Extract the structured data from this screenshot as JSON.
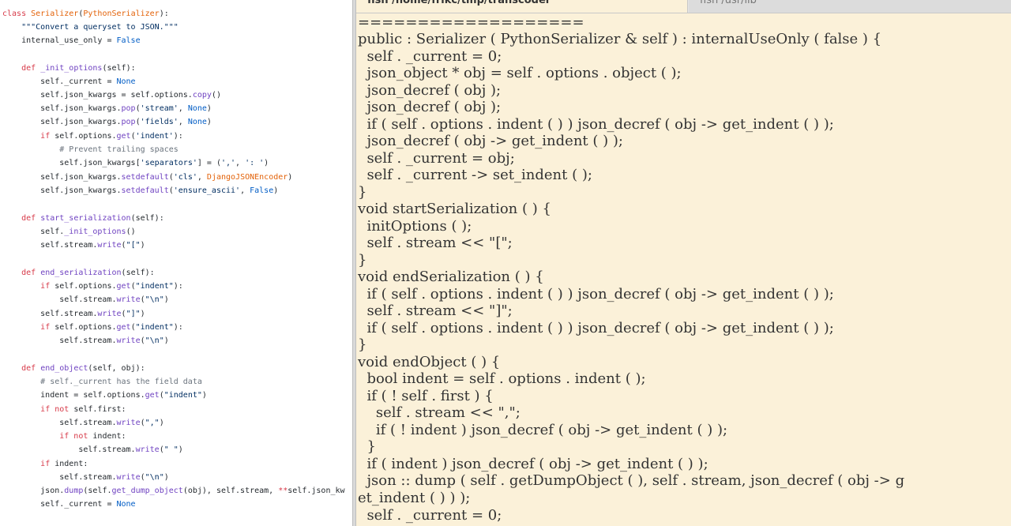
{
  "left_editor": {
    "line_1": {
      "a": "class ",
      "b": "Serializer",
      "c": "(",
      "d": "PythonSerializer",
      "e": "):"
    },
    "line_2": {
      "a": "    \"\"\"Convert a queryset to JSON.\"\"\""
    },
    "line_3": {
      "a": "    internal_use_only = ",
      "b": "False"
    },
    "line_5": {
      "a": "    ",
      "b": "def ",
      "c": "_init_options",
      "d": "(self):"
    },
    "line_6": {
      "a": "        self._current = ",
      "b": "None"
    },
    "line_7": {
      "a": "        self.json_kwargs = self.options.",
      "b": "copy",
      "c": "()"
    },
    "line_8": {
      "a": "        self.json_kwargs.",
      "b": "pop",
      "c": "(",
      "d": "'stream'",
      "e": ", ",
      "f": "None",
      "g": ")"
    },
    "line_9": {
      "a": "        self.json_kwargs.",
      "b": "pop",
      "c": "(",
      "d": "'fields'",
      "e": ", ",
      "f": "None",
      "g": ")"
    },
    "line_10": {
      "a": "        ",
      "b": "if ",
      "c": "self.options.",
      "d": "get",
      "e": "(",
      "f": "'indent'",
      "g": "):"
    },
    "line_11": {
      "a": "            # Prevent trailing spaces"
    },
    "line_12": {
      "a": "            self.json_kwargs[",
      "b": "'separators'",
      "c": "] = (",
      "d": "','",
      "e": ", ",
      "f": "': '",
      "g": ")"
    },
    "line_13": {
      "a": "        self.json_kwargs.",
      "b": "setdefault",
      "c": "(",
      "d": "'cls'",
      "e": ", ",
      "f": "DjangoJSONEncoder",
      "g": ")"
    },
    "line_14": {
      "a": "        self.json_kwargs.",
      "b": "setdefault",
      "c": "(",
      "d": "'ensure_ascii'",
      "e": ", ",
      "f": "False",
      "g": ")"
    },
    "line_16": {
      "a": "    ",
      "b": "def ",
      "c": "start_serialization",
      "d": "(self):"
    },
    "line_17": {
      "a": "        self.",
      "b": "_init_options",
      "c": "()"
    },
    "line_18": {
      "a": "        self.stream.",
      "b": "write",
      "c": "(",
      "d": "\"[\"",
      "e": ")"
    },
    "line_20": {
      "a": "    ",
      "b": "def ",
      "c": "end_serialization",
      "d": "(self):"
    },
    "line_21": {
      "a": "        ",
      "b": "if ",
      "c": "self.options.",
      "d": "get",
      "e": "(",
      "f": "\"indent\"",
      "g": "):"
    },
    "line_22": {
      "a": "            self.stream.",
      "b": "write",
      "c": "(",
      "d": "\"\\n\"",
      "e": ")"
    },
    "line_23": {
      "a": "        self.stream.",
      "b": "write",
      "c": "(",
      "d": "\"]\"",
      "e": ")"
    },
    "line_24": {
      "a": "        ",
      "b": "if ",
      "c": "self.options.",
      "d": "get",
      "e": "(",
      "f": "\"indent\"",
      "g": "):"
    },
    "line_25": {
      "a": "            self.stream.",
      "b": "write",
      "c": "(",
      "d": "\"\\n\"",
      "e": ")"
    },
    "line_27": {
      "a": "    ",
      "b": "def ",
      "c": "end_object",
      "d": "(self, obj):"
    },
    "line_28": {
      "a": "        # self._current has the field data"
    },
    "line_29": {
      "a": "        indent = self.options.",
      "b": "get",
      "c": "(",
      "d": "\"indent\"",
      "e": ")"
    },
    "line_30": {
      "a": "        ",
      "b": "if not ",
      "c": "self.first:"
    },
    "line_31": {
      "a": "            self.stream.",
      "b": "write",
      "c": "(",
      "d": "\",\"",
      "e": ")"
    },
    "line_32": {
      "a": "            ",
      "b": "if not ",
      "c": "indent:"
    },
    "line_33": {
      "a": "                self.stream.",
      "b": "write",
      "c": "(",
      "d": "\" \"",
      "e": ")"
    },
    "line_34": {
      "a": "        ",
      "b": "if ",
      "c": "indent:"
    },
    "line_35": {
      "a": "            self.stream.",
      "b": "write",
      "c": "(",
      "d": "\"\\n\"",
      "e": ")"
    },
    "line_36": {
      "a": "        json.",
      "b": "dump",
      "c": "(self.",
      "d": "get_dump_object",
      "e": "(obj), self.stream, ",
      "f": "**",
      "g": "self.json_kw"
    },
    "line_37": {
      "a": "        self._current = ",
      "b": "None"
    }
  },
  "right_editor": {
    "tab_active": "fish /home/frikc/tmp/transcoder",
    "tab_close": "×",
    "tab_inactive": "fish /usr/lib",
    "lines": [
      "===================",
      "public : Serializer ( PythonSerializer & self ) : internalUseOnly ( false ) {",
      "  self . _current = 0;",
      "  json_object * obj = self . options . object ( );",
      "  json_decref ( obj );",
      "  json_decref ( obj );",
      "  if ( self . options . indent ( ) ) json_decref ( obj -> get_indent ( ) );",
      "  json_decref ( obj -> get_indent ( ) );",
      "  self . _current = obj;",
      "  self . _current -> set_indent ( );",
      "}",
      "void startSerialization ( ) {",
      "  initOptions ( );",
      "  self . stream << \"[\";",
      "}",
      "void endSerialization ( ) {",
      "  if ( self . options . indent ( ) ) json_decref ( obj -> get_indent ( ) );",
      "  self . stream << \"]\";",
      "  if ( self . options . indent ( ) ) json_decref ( obj -> get_indent ( ) );",
      "}",
      "void endObject ( ) {",
      "  bool indent = self . options . indent ( );",
      "  if ( ! self . first ) {",
      "    self . stream << \",\";",
      "    if ( ! indent ) json_decref ( obj -> get_indent ( ) );",
      "  }",
      "  if ( indent ) json_decref ( obj -> get_indent ( ) );",
      "  json :: dump ( self . getDumpObject ( ), self . stream, json_decref ( obj -> g",
      "et_indent ( ) ) );",
      "  self . _current = 0;"
    ]
  },
  "colors": {
    "keyword": "#d73a49",
    "class_name": "#e36209",
    "function": "#6f42c1",
    "string": "#032f62",
    "comment": "#6a737d",
    "constant": "#005cc5",
    "terminal_background": "#fbf1d9"
  }
}
